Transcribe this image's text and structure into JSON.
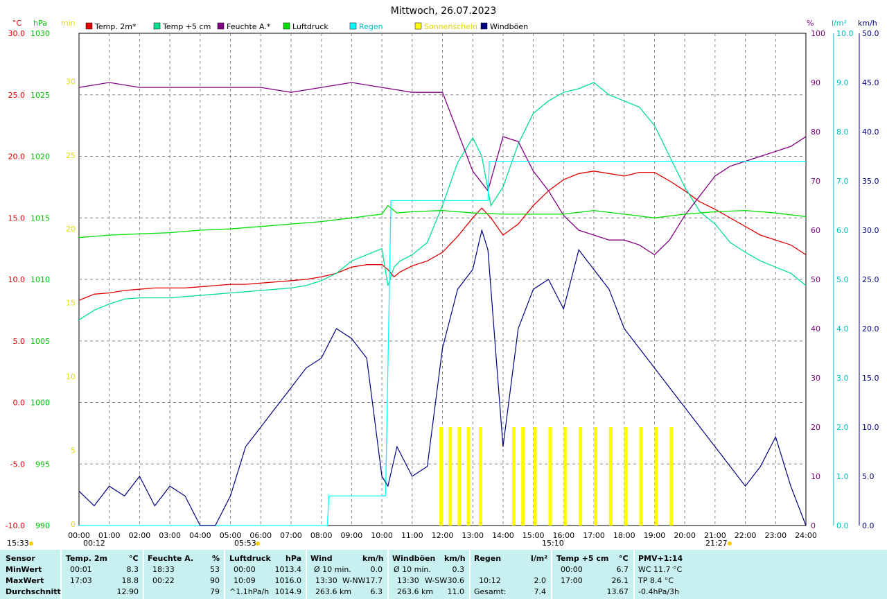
{
  "title": "Mittwoch, 26.07.2023",
  "axes": {
    "celsius_unit": "°C",
    "hpa_unit": "hPa",
    "min_unit": "min",
    "percent_unit": "%",
    "rain_unit": "l/m²",
    "wind_unit": "km/h"
  },
  "legend": [
    {
      "label": "Temp. 2m*",
      "color": "#e00000"
    },
    {
      "label": "Temp +5 cm",
      "color": "#00e090"
    },
    {
      "label": "Feuchte A.*",
      "color": "#800080"
    },
    {
      "label": "Luftdruck",
      "color": "#00e000"
    },
    {
      "label": "Regen",
      "color": "#00ffff"
    },
    {
      "label": "Sonnenschein",
      "color": "#ffff00"
    },
    {
      "label": "Windböen",
      "color": "#000080"
    }
  ],
  "markers": {
    "left": "15:33",
    "a": "00:12",
    "b": "05:53",
    "c": "15:10",
    "d": "21:27"
  },
  "chart_data": {
    "type": "line",
    "title": "Mittwoch, 26.07.2023",
    "x_ticks": [
      "00:00",
      "01:00",
      "02:00",
      "03:00",
      "04:00",
      "05:00",
      "06:00",
      "07:00",
      "08:00",
      "09:00",
      "10:00",
      "11:00",
      "12:00",
      "13:00",
      "14:00",
      "15:00",
      "16:00",
      "17:00",
      "18:00",
      "19:00",
      "20:00",
      "21:00",
      "22:00",
      "23:00",
      "24:00"
    ],
    "xlim": [
      0,
      24
    ],
    "axes_ticks": {
      "temp_c": [
        "-10.0",
        "-5.0",
        "0.0",
        "5.0",
        "10.0",
        "15.0",
        "20.0",
        "25.0",
        "30.0"
      ],
      "pressure_hpa": [
        "990",
        "995",
        "1000",
        "1005",
        "1010",
        "1015",
        "1020",
        "1025",
        "1030"
      ],
      "sun_min": [
        "0",
        "5",
        "10",
        "15",
        "20",
        "25",
        "30"
      ],
      "humidity_pct": [
        "0",
        "10",
        "20",
        "30",
        "40",
        "50",
        "60",
        "70",
        "80",
        "90",
        "100"
      ],
      "rain_l": [
        "0.0",
        "1.0",
        "2.0",
        "3.0",
        "4.0",
        "5.0",
        "6.0",
        "7.0",
        "8.0",
        "9.0",
        "10.0"
      ],
      "wind_kmh": [
        "0.0",
        "5.0",
        "10.0",
        "15.0",
        "20.0",
        "25.0",
        "30.0",
        "35.0",
        "40.0",
        "45.0",
        "50.0"
      ]
    },
    "ylim_temp": [
      -10,
      30
    ],
    "ylim_pressure": [
      990,
      1030
    ],
    "ylim_humidity": [
      0,
      100
    ],
    "ylim_rain": [
      0,
      10
    ],
    "ylim_wind": [
      0,
      50
    ],
    "series": [
      {
        "name": "Temp. 2m*",
        "axis": "temp",
        "x": [
          0,
          0.5,
          1,
          1.5,
          2,
          2.5,
          3,
          3.5,
          4,
          4.5,
          5,
          5.5,
          6,
          6.5,
          7,
          7.5,
          8,
          8.5,
          9,
          9.5,
          10,
          10.2,
          10.4,
          10.6,
          11,
          11.5,
          12,
          12.5,
          13,
          13.3,
          13.6,
          14,
          14.5,
          15,
          15.5,
          16,
          16.5,
          17,
          17.5,
          18,
          18.5,
          19,
          19.5,
          20,
          20.5,
          21,
          21.5,
          22,
          22.5,
          23,
          23.5,
          24
        ],
        "y": [
          8.3,
          8.8,
          8.9,
          9.1,
          9.2,
          9.3,
          9.3,
          9.3,
          9.4,
          9.5,
          9.6,
          9.6,
          9.7,
          9.8,
          9.9,
          10.0,
          10.2,
          10.5,
          11.0,
          11.2,
          11.2,
          10.8,
          10.2,
          10.6,
          11.1,
          11.5,
          12.2,
          13.5,
          15.0,
          15.8,
          15.0,
          13.6,
          14.5,
          16.0,
          17.2,
          18.1,
          18.6,
          18.8,
          18.6,
          18.4,
          18.7,
          18.7,
          18.0,
          17.2,
          16.3,
          15.7,
          15.0,
          14.3,
          13.6,
          13.2,
          12.8,
          12.0
        ]
      },
      {
        "name": "Temp +5 cm",
        "axis": "temp",
        "x": [
          0,
          0.5,
          1,
          1.5,
          2,
          2.5,
          3,
          3.5,
          4,
          4.5,
          5,
          5.5,
          6,
          6.5,
          7,
          7.5,
          8,
          8.5,
          9,
          9.5,
          10,
          10.2,
          10.4,
          10.6,
          11,
          11.5,
          12,
          12.5,
          13,
          13.3,
          13.6,
          14,
          14.5,
          15,
          15.5,
          16,
          16.5,
          17,
          17.5,
          18,
          18.5,
          19,
          19.5,
          20,
          20.5,
          21,
          21.5,
          22,
          22.5,
          23,
          23.5,
          24
        ],
        "y": [
          6.7,
          7.5,
          8.0,
          8.4,
          8.5,
          8.5,
          8.5,
          8.6,
          8.7,
          8.8,
          8.9,
          9.0,
          9.1,
          9.2,
          9.3,
          9.5,
          9.9,
          10.5,
          11.5,
          12.0,
          12.5,
          9.5,
          11.0,
          11.5,
          12.0,
          13.0,
          16.0,
          19.5,
          21.5,
          20.0,
          16.0,
          17.5,
          21.0,
          23.5,
          24.5,
          25.2,
          25.5,
          26.0,
          25.0,
          24.5,
          24.0,
          22.5,
          20.0,
          17.5,
          15.5,
          14.5,
          13.0,
          12.2,
          11.5,
          11.0,
          10.5,
          9.5
        ]
      },
      {
        "name": "Feuchte A.*",
        "axis": "humidity",
        "x": [
          0,
          1,
          2,
          3,
          4,
          5,
          6,
          7,
          8,
          9,
          10,
          11,
          12,
          12.5,
          13,
          13.5,
          14,
          14.5,
          15,
          15.5,
          16,
          16.5,
          17,
          17.5,
          18,
          18.5,
          19,
          19.5,
          20,
          20.5,
          21,
          21.5,
          22,
          22.5,
          23,
          23.5,
          24
        ],
        "y": [
          89,
          90,
          89,
          89,
          89,
          89,
          89,
          88,
          89,
          90,
          89,
          88,
          88,
          80,
          72,
          68,
          79,
          78,
          72,
          68,
          63,
          60,
          59,
          58,
          58,
          57,
          55,
          58,
          63,
          67,
          71,
          73,
          74,
          75,
          76,
          77,
          79
        ]
      },
      {
        "name": "Luftdruck",
        "axis": "pressure",
        "x": [
          0,
          1,
          2,
          3,
          4,
          5,
          6,
          7,
          8,
          9,
          10,
          10.2,
          10.5,
          11,
          12,
          13,
          14,
          15,
          16,
          17,
          18,
          19,
          20,
          21,
          22,
          23,
          24
        ],
        "y": [
          1013.4,
          1013.6,
          1013.7,
          1013.8,
          1014.0,
          1014.1,
          1014.3,
          1014.5,
          1014.7,
          1015.0,
          1015.3,
          1016.0,
          1015.4,
          1015.5,
          1015.6,
          1015.4,
          1015.3,
          1015.3,
          1015.3,
          1015.6,
          1015.3,
          1015.0,
          1015.3,
          1015.5,
          1015.6,
          1015.4,
          1015.1
        ]
      },
      {
        "name": "Regen",
        "axis": "rain",
        "x": [
          0,
          8.2,
          8.25,
          8.5,
          9,
          10,
          10.12,
          10.15,
          10.3,
          11,
          12,
          13,
          13.5,
          13.55,
          14,
          15,
          16,
          17,
          18,
          19,
          20,
          21,
          22,
          23,
          24
        ],
        "y": [
          0,
          0,
          0.6,
          0.6,
          0.6,
          0.6,
          0.6,
          1.5,
          6.6,
          6.6,
          6.6,
          6.6,
          6.6,
          7.4,
          7.4,
          7.4,
          7.4,
          7.4,
          7.4,
          7.4,
          7.4,
          7.4,
          7.4,
          7.4,
          7.4
        ]
      },
      {
        "name": "Sonnenschein",
        "axis": "sun",
        "x": [
          11.9,
          12.2,
          12.5,
          12.8,
          13.2,
          14.3,
          14.6,
          15.0,
          15.5,
          16.0,
          16.5,
          17.0,
          17.5,
          18.0,
          18.5,
          19.0,
          19.5
        ],
        "y": [
          6,
          6,
          6,
          6,
          6,
          6,
          6,
          6,
          6,
          6,
          6,
          6,
          6,
          6,
          6,
          6,
          6
        ]
      },
      {
        "name": "Windböen",
        "axis": "wind",
        "x": [
          0,
          0.5,
          1,
          1.5,
          2,
          2.5,
          3,
          3.5,
          4,
          4.5,
          5,
          5.5,
          6,
          6.5,
          7,
          7.5,
          8,
          8.5,
          9,
          9.5,
          10,
          10.2,
          10.5,
          11,
          11.5,
          12,
          12.5,
          13,
          13.3,
          13.5,
          14,
          14.5,
          15,
          15.5,
          16,
          16.5,
          17,
          17.5,
          18,
          18.5,
          19,
          19.5,
          20,
          20.5,
          21,
          21.5,
          22,
          22.5,
          23,
          23.5,
          24
        ],
        "y": [
          3.5,
          2,
          4,
          3,
          5,
          2,
          4,
          3,
          0,
          0,
          3,
          8,
          10,
          12,
          14,
          16,
          17,
          20,
          19,
          17,
          5,
          4,
          8,
          5,
          6,
          18,
          24,
          26,
          30,
          28,
          8,
          20,
          24,
          25,
          22,
          28,
          26,
          24,
          20,
          18,
          16,
          14,
          12,
          10,
          8,
          6,
          4,
          6,
          9,
          4,
          0
        ]
      }
    ]
  },
  "table": {
    "sensor": {
      "header": "Sensor",
      "min": "MinWert",
      "max": "MaxWert",
      "avg": "Durchschnitt"
    },
    "temp2m": {
      "header": "Temp. 2m",
      "unit": "°C",
      "min_time": "00:01",
      "min_val": "8.3",
      "max_time": "17:03",
      "max_val": "18.8",
      "avg": "12.90"
    },
    "feuchte": {
      "header": "Feuchte A.",
      "unit": "%",
      "min_time": "18:33",
      "min_val": "53",
      "max_time": "00:22",
      "max_val": "90",
      "avg": "79"
    },
    "luftdruck": {
      "header": "Luftdruck",
      "unit": "hPa",
      "min_time": "00:00",
      "min_val": "1013.4",
      "max_time": "10:09",
      "max_val": "1016.0",
      "trend": "^1.1hPa/h",
      "avg": "1014.9"
    },
    "wind": {
      "header": "Wind",
      "unit": "km/h",
      "r1_label": "Ø 10 min.",
      "r1_val": "0.0",
      "r2_time": "13:30",
      "r2_dir": "W-NW",
      "r2_val": "17.7",
      "r3_dist": "263.6 km",
      "r3_val": "6.3"
    },
    "windboeen": {
      "header": "Windböen",
      "unit": "km/h",
      "r1_label": "Ø 10 min.",
      "r1_val": "0.3",
      "r2_time": "13:30",
      "r2_dir": "W-SW",
      "r2_val": "30.6",
      "r3_dist": "263.6 km",
      "r3_val": "11.0"
    },
    "regen": {
      "header": "Regen",
      "unit": "l/m²",
      "r2_time": "10:12",
      "r2_val": "2.0",
      "r3_label": "Gesamt:",
      "r3_val": "7.4"
    },
    "temp5cm": {
      "header": "Temp +5 cm",
      "unit": "°C",
      "min_time": "00:00",
      "min_val": "6.7",
      "max_time": "17:00",
      "max_val": "26.1",
      "avg": "13.67"
    },
    "pmv": {
      "header": "PMV+1:14",
      "r1": "WC 11.7 °C",
      "r2": "TP 8.4 °C",
      "r3": "-0.4hPa/3h"
    }
  }
}
